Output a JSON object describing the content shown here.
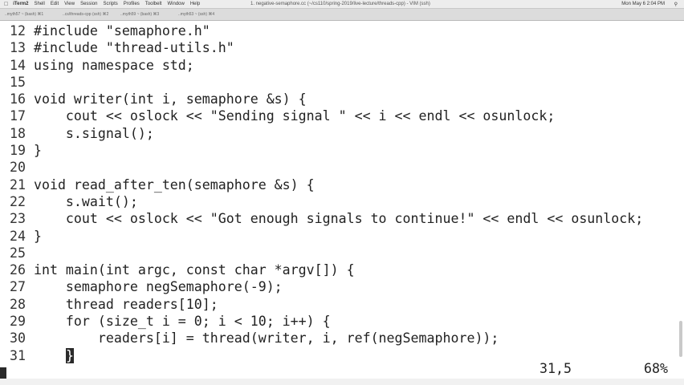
{
  "menubar": {
    "app": "iTerm2",
    "items": [
      "Shell",
      "Edit",
      "View",
      "Session",
      "Scripts",
      "Profiles",
      "Toolbelt",
      "Window",
      "Help"
    ],
    "window_title": "1. negative-semaphore.cc (~/cs110/spring-2019/live-lecture/threads-cpp) - VIM (ssh)",
    "clock": "Mon May 6  2:04 PM"
  },
  "tabs": [
    "..myth57 ~ (bash)  ⌘1",
    "..cs/threads-cpp (ssh)  ⌘2",
    "..myth59 ~ (bash)  ⌘3",
    "..myth53 ~ (ssh)  ⌘4"
  ],
  "editor": {
    "lines": [
      {
        "n": "12",
        "code": " #include \"semaphore.h\""
      },
      {
        "n": "13",
        "code": " #include \"thread-utils.h\""
      },
      {
        "n": "14",
        "code": " using namespace std;"
      },
      {
        "n": "15",
        "code": ""
      },
      {
        "n": "16",
        "code": " void writer(int i, semaphore &s) {"
      },
      {
        "n": "17",
        "code": "     cout << oslock << \"Sending signal \" << i << endl << osunlock;"
      },
      {
        "n": "18",
        "code": "     s.signal();"
      },
      {
        "n": "19",
        "code": " }"
      },
      {
        "n": "20",
        "code": ""
      },
      {
        "n": "21",
        "code": " void read_after_ten(semaphore &s) {"
      },
      {
        "n": "22",
        "code": "     s.wait();"
      },
      {
        "n": "23",
        "code": "     cout << oslock << \"Got enough signals to continue!\" << endl << osunlock;"
      },
      {
        "n": "24",
        "code": " }"
      },
      {
        "n": "25",
        "code": ""
      },
      {
        "n": "26",
        "code": " int main(int argc, const char *argv[]) {"
      },
      {
        "n": "27",
        "code": "     semaphore negSemaphore(-9);"
      },
      {
        "n": "28",
        "code": "     thread readers[10];"
      },
      {
        "n": "29",
        "code": "     for (size_t i = 0; i < 10; i++) {"
      },
      {
        "n": "30",
        "code": "         readers[i] = thread(writer, i, ref(negSemaphore));"
      },
      {
        "n": "31",
        "code": "     "
      }
    ],
    "cursor_char": "}"
  },
  "status": {
    "position": "31,5",
    "percent": "68%"
  }
}
